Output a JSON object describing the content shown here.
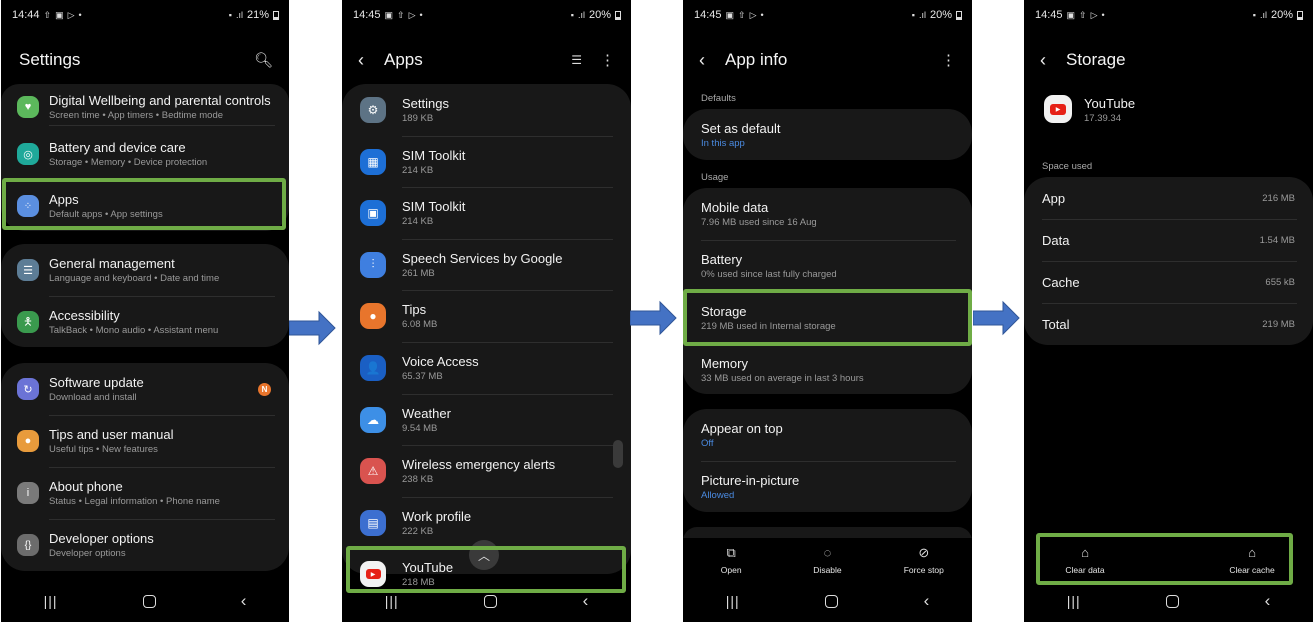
{
  "screens": {
    "settings": {
      "status": {
        "time": "14:44",
        "battery": "21%"
      },
      "title": "Settings",
      "items": [
        {
          "label": "Digital Wellbeing and parental controls",
          "sub": "Screen time  •  App timers  •  Bedtime mode",
          "icon": "digital-wellbeing-icon",
          "color": "#5cb85c"
        },
        {
          "label": "Battery and device care",
          "sub": "Storage  •  Memory  •  Device protection",
          "icon": "device-care-icon",
          "color": "#1fa99a"
        },
        {
          "label": "Apps",
          "sub": "Default apps  •  App settings",
          "icon": "apps-icon",
          "color": "#5b8fe0"
        },
        {
          "label": "General management",
          "sub": "Language and keyboard  •  Date and time",
          "icon": "general-management-icon",
          "color": "#5d7d96"
        },
        {
          "label": "Accessibility",
          "sub": "TalkBack  •  Mono audio  •  Assistant menu",
          "icon": "accessibility-icon",
          "color": "#3a9a4e"
        },
        {
          "label": "Software update",
          "sub": "Download and install",
          "icon": "software-update-icon",
          "color": "#6b73d6",
          "badge": "N"
        },
        {
          "label": "Tips and user manual",
          "sub": "Useful tips  •  New features",
          "icon": "tips-icon",
          "color": "#e89b3c"
        },
        {
          "label": "About phone",
          "sub": "Status  •  Legal information  •  Phone name",
          "icon": "about-phone-icon",
          "color": "#7a7a7a"
        },
        {
          "label": "Developer options",
          "sub": "Developer options",
          "icon": "developer-options-icon",
          "color": "#6c6c6c"
        }
      ]
    },
    "apps": {
      "status": {
        "time": "14:45",
        "battery": "20%"
      },
      "title": "Apps",
      "items": [
        {
          "label": "Settings",
          "sub": "189 KB",
          "color": "#5d7385"
        },
        {
          "label": "SIM Toolkit",
          "sub": "214 KB",
          "color": "#1d6fd6"
        },
        {
          "label": "SIM Toolkit",
          "sub": "214 KB",
          "color": "#1d6fd6"
        },
        {
          "label": "Speech Services by Google",
          "sub": "261 MB",
          "color": "#3f7fe0"
        },
        {
          "label": "Tips",
          "sub": "6.08 MB",
          "color": "#e8752c"
        },
        {
          "label": "Voice Access",
          "sub": "65.37 MB",
          "color": "#1a5fc4"
        },
        {
          "label": "Weather",
          "sub": "9.54 MB",
          "color": "#3d8fe6"
        },
        {
          "label": "Wireless emergency alerts",
          "sub": "238 KB",
          "color": "#d9534f"
        },
        {
          "label": "Work profile",
          "sub": "222 KB",
          "color": "#3c6fd0"
        },
        {
          "label": "YouTube",
          "sub": "218 MB",
          "color": "#f2f2f2"
        }
      ]
    },
    "app_info": {
      "status": {
        "time": "14:45",
        "battery": "20%"
      },
      "title": "App info",
      "sections": {
        "defaults": "Defaults",
        "usage": "Usage"
      },
      "set_as_default": {
        "label": "Set as default",
        "sub": "In this app"
      },
      "usage": [
        {
          "label": "Mobile data",
          "sub": "7.96 MB used since 16 Aug"
        },
        {
          "label": "Battery",
          "sub": "0% used since last fully charged"
        },
        {
          "label": "Storage",
          "sub": "219 MB used in Internal storage"
        },
        {
          "label": "Memory",
          "sub": "33 MB used on average in last 3 hours"
        }
      ],
      "permissions": [
        {
          "label": "Appear on top",
          "sub": "Off"
        },
        {
          "label": "Picture-in-picture",
          "sub": "Allowed"
        }
      ],
      "actions": {
        "open": "Open",
        "disable": "Disable",
        "force_stop": "Force stop"
      }
    },
    "storage": {
      "status": {
        "time": "14:45",
        "battery": "20%"
      },
      "title": "Storage",
      "app_name": "YouTube",
      "app_version": "17.39.34",
      "space_used_label": "Space used",
      "rows": [
        {
          "label": "App",
          "value": "216 MB"
        },
        {
          "label": "Data",
          "value": "1.54 MB"
        },
        {
          "label": "Cache",
          "value": "655 kB"
        },
        {
          "label": "Total",
          "value": "219 MB"
        }
      ],
      "actions": {
        "clear_data": "Clear data",
        "clear_cache": "Clear cache"
      }
    }
  },
  "colors": {
    "highlight": "#6fac46",
    "arrow": "#4472c4",
    "link_blue": "#4a8ae0"
  }
}
